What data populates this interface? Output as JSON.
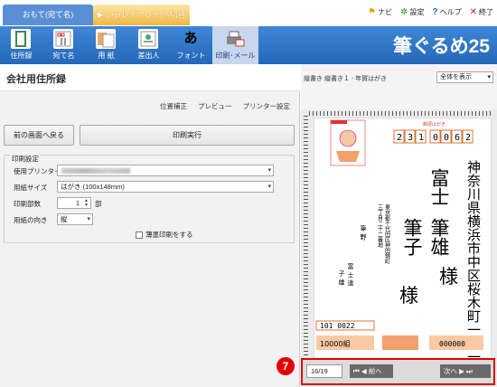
{
  "top_tabs": {
    "front": "おもて(宛て名)",
    "back": "▶うら(レイアウト)へ切替"
  },
  "top_menu": {
    "navi": "ナビ",
    "settings": "設定",
    "help": "ヘルプ",
    "quit": "終了"
  },
  "toolbar": {
    "items": [
      "住所録",
      "宛て名",
      "用 紙",
      "差出人",
      "フォント",
      "印刷･メール"
    ],
    "brand": "筆ぐるめ25"
  },
  "left": {
    "title": "会社用住所録",
    "links": [
      "位置補正",
      "プレビュー",
      "プリンター設定"
    ],
    "back_button": "前の画面へ戻る",
    "print_button": "印刷実行",
    "settings_legend": "印刷設定",
    "printer_label": "使用プリンター",
    "paper_label": "用紙サイズ",
    "paper_value": "はがき (100x148mm)",
    "copies_label": "印刷部数",
    "copies_value": "1",
    "copies_unit": "部",
    "orientation_label": "用紙の向き",
    "orientation_value": "縦",
    "thin_paper_label": "薄墨印刷をする"
  },
  "right": {
    "layout_label": "縦書き 縦書き１ - 年賀はがき",
    "zoom_value": "全体を表示",
    "postcard": {
      "header_small": "郵便はがき",
      "postal_code_digits": [
        "2",
        "3",
        "1",
        "0",
        "0",
        "6",
        "2"
      ],
      "address_line1": "神奈川県横浜市中区桜木町一ー一",
      "recipient_name_l1": "富士",
      "recipient_name_l2": "筆雄",
      "recipient_name_l3": "筆子",
      "honorific": "様",
      "sender_address1": "東京都千代田区神田錦町",
      "sender_address2": "三丁目二十二番地",
      "sender_name1": "筆 野",
      "sender_name2": "富 士 達",
      "sender_name3": "子 雄",
      "sender_postal": "101 0022",
      "lottery1": "10000組",
      "lottery2": "000000"
    },
    "pager": {
      "position": "16/19",
      "prev": "前へ",
      "next": "次へ"
    }
  },
  "callout_badge": "7",
  "colors": {
    "toolbar_blue": "#2f74c8",
    "highlight_red": "#e00000",
    "stamp_orange": "#f2a06e"
  }
}
